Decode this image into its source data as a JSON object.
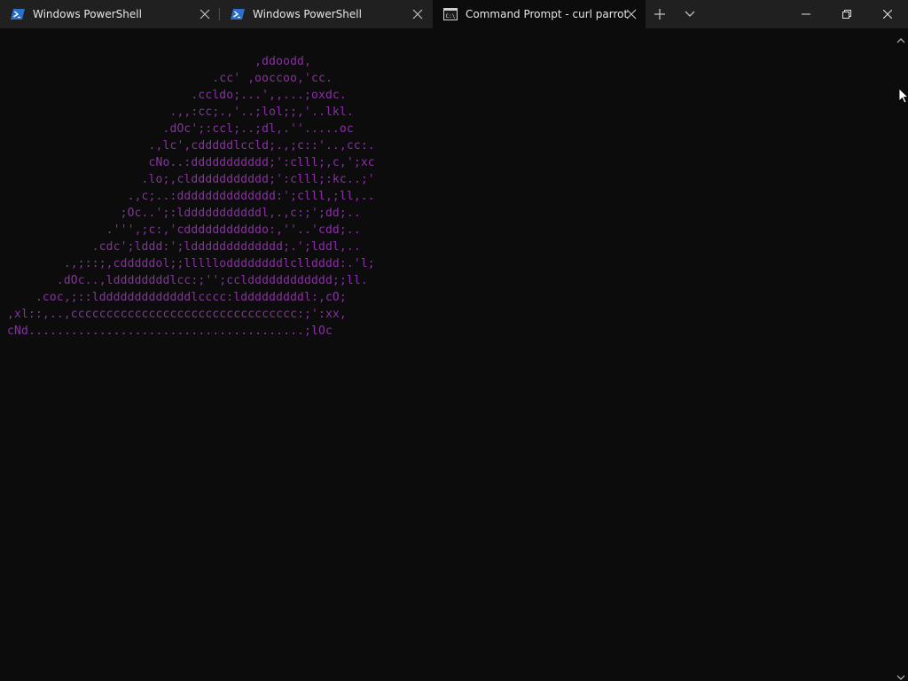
{
  "tabs": [
    {
      "label": "Windows PowerShell",
      "icon": "powershell-icon",
      "active": false
    },
    {
      "label": "Windows PowerShell",
      "icon": "powershell-icon",
      "active": false
    },
    {
      "label": "Command Prompt - curl  parrot",
      "icon": "cmd-icon",
      "active": true
    }
  ],
  "toolbar": {
    "new_tab_icon": "plus-icon",
    "dropdown_icon": "chevron-down-icon"
  },
  "window_controls": {
    "minimize_icon": "minimize-icon",
    "restore_icon": "restore-icon",
    "close_icon": "close-icon"
  },
  "terminal": {
    "text_color": "#8a2fa4",
    "background": "#0c0c0c",
    "ascii_art": "                                   ,ddoodd,\n                             .cc' ,ooccoo,'cc.\n                          .ccldo;...',,...;oxdc.\n                       .,,:cc;.,'..;lol;;,'..lkl.\n                      .dOc';:ccl;..;dl,.''.....oc\n                    .,lc',cdddddlccld;.,;c::'..,cc:.\n                    cNo..:ddddddddddd;':clll;,c,';xc\n                   .lo;,clddddddddddd;':clll;:kc..;'\n                 .,c;..:dddddddddddddd:';clll,;ll,..\n                ;Oc..';:ldddddddddddl,.,c:;';dd;..\n              .''',;c:,'cdddddddddddo:,''..'cdd;..\n            .cdc';lddd:';lddddddddddddd;.';lddl,..\n        .,;::;,cdddddol;;llllloddddddddlclldddd:.'l;\n       .dOc..,lddddddddlcc:;'';ccldddddddddddd;;ll.\n    .coc,;::ldddddddddddddlcccc:ldddddddddl:,cO;\n,xl::,..,cccccccccccccccccccccccccccccccc:;':xx,\ncNd.......................................;lOc"
  },
  "scrollbar": {
    "up_icon": "scroll-up-arrow-icon",
    "down_icon": "scroll-down-arrow-icon"
  }
}
